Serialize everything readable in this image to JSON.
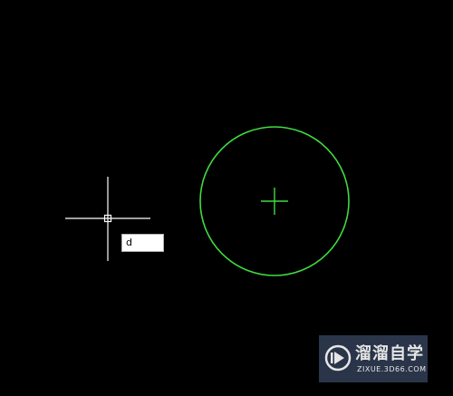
{
  "canvas": {
    "background": "#000000",
    "crosshair_color": "#ffffff",
    "circle_color": "#3fdc3f"
  },
  "command_input": {
    "value": "d"
  },
  "watermark": {
    "title": "溜溜自学",
    "url": "ZIXUE.3D66.COM",
    "logo": "play-logo-icon"
  }
}
